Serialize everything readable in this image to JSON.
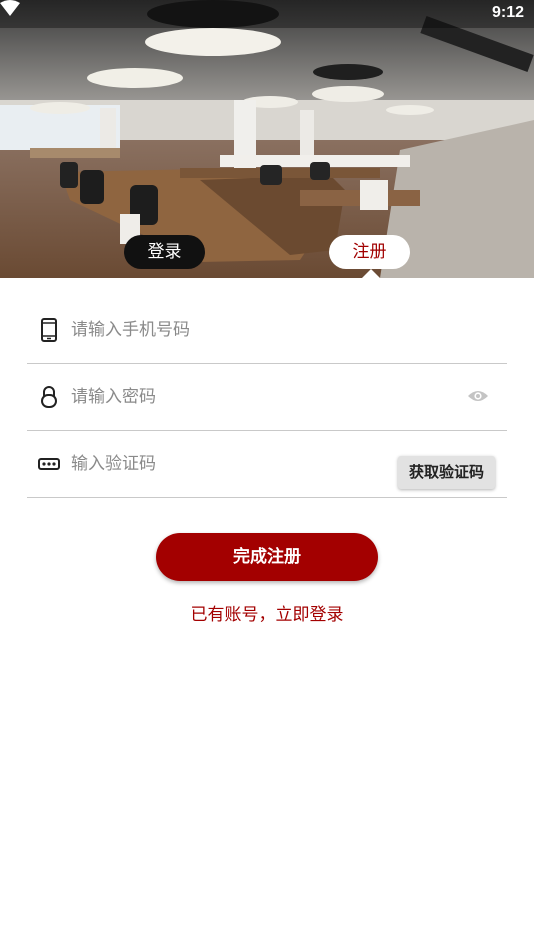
{
  "status_bar": {
    "time": "9:12"
  },
  "tabs": {
    "login": "登录",
    "register": "注册"
  },
  "form": {
    "phone_placeholder": "请输入手机号码",
    "password_placeholder": "请输入密码",
    "code_placeholder": "输入验证码",
    "get_code_label": "获取验证码"
  },
  "submit_label": "完成注册",
  "login_link": "已有账号，立即登录",
  "colors": {
    "accent": "#a30000",
    "tab_dark": "#111111"
  },
  "icons": [
    "wifi-icon",
    "phone-icon",
    "lock-icon",
    "code-icon",
    "eye-icon"
  ]
}
